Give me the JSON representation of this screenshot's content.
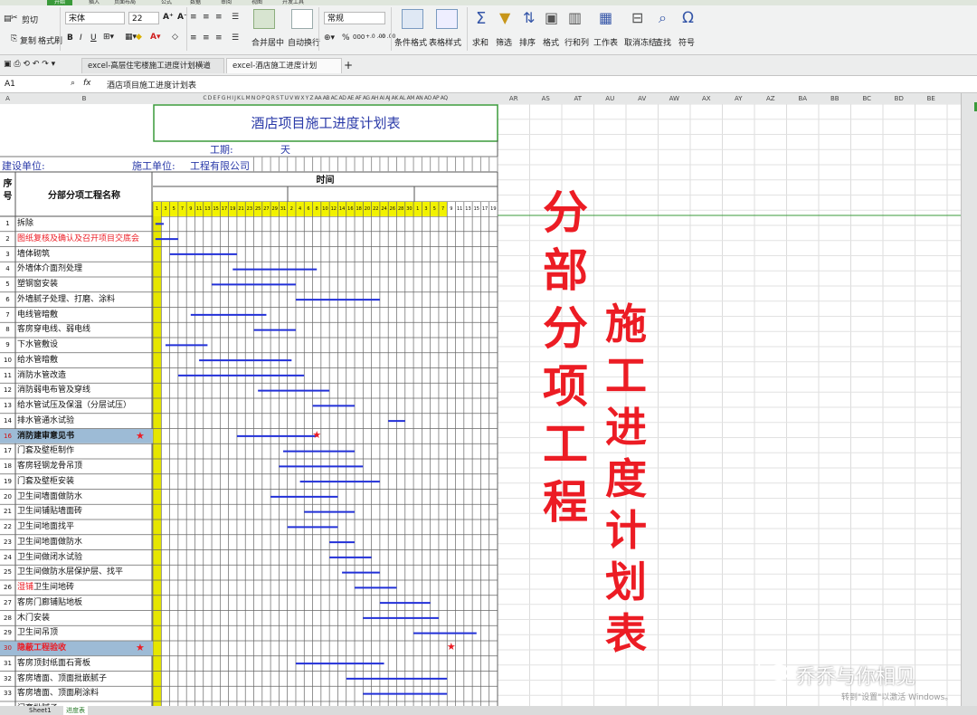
{
  "ribbon": {
    "tabs": [
      "开始",
      "插入",
      "页面布局",
      "公式",
      "数据",
      "审阅",
      "视图",
      "开发工具"
    ],
    "clipboard": {
      "cut": "剪切",
      "copy": "复制",
      "format_painter": "格式刷"
    },
    "font": {
      "name": "宋体",
      "size": "22"
    },
    "number_format": "常规",
    "buttons": {
      "merge_center": "合并居中",
      "wrap_text": "自动换行",
      "cond_format": "条件格式",
      "table_style": "表格样式",
      "sum": "求和",
      "filter": "筛选",
      "sort": "排序",
      "format": "格式",
      "rows_cols": "行和列",
      "worksheet": "工作表",
      "freeze": "取消冻结",
      "find": "查找",
      "symbol": "符号"
    },
    "font_buttons": [
      "B",
      "I",
      "U"
    ],
    "percent": "%",
    "thousands": "000",
    "dec_inc": "+.0 .00",
    "dec_dec": "-.0 .00"
  },
  "doc_tabs": {
    "tab1": "excel-高层住宅楼施工进度计划横道图.xls",
    "tab2": "excel-酒店施工进度计划表.xls",
    "new_tab": "+"
  },
  "formula_bar": {
    "name_box": "A1",
    "fx": "fx",
    "content": "酒店项目施工进度计划表"
  },
  "col_headers": {
    "a": "A",
    "b": "B",
    "mini": "C D E F G H I J K L M N O P Q R S T U V W X Y Z AA AB AC AD AE AF AG AH AI AJ AK AL AM AN AO AP AQ",
    "right": [
      "AR",
      "AS",
      "AT",
      "AU",
      "AV",
      "AW",
      "AX",
      "AY",
      "AZ",
      "BA",
      "BB",
      "BC",
      "BD",
      "BE"
    ]
  },
  "sheet": {
    "title": "酒店项目施工进度计划表",
    "duration_label": "工期:",
    "duration_unit": "天",
    "owner_label": "建设单位:",
    "contractor_label": "施工单位:",
    "contractor_name": "工程有限公司",
    "time_label": "时间",
    "seq_label": "序号",
    "task_header": "分部分项工程名称",
    "days": [
      "1",
      "3",
      "5",
      "7",
      "9",
      "11",
      "13",
      "15",
      "17",
      "19",
      "21",
      "23",
      "25",
      "27",
      "29",
      "31",
      "2",
      "4",
      "6",
      "8",
      "10",
      "12",
      "14",
      "16",
      "18",
      "20",
      "22",
      "24",
      "26",
      "28",
      "30",
      "1",
      "3",
      "5",
      "7",
      "9",
      "11",
      "13",
      "15",
      "17",
      "19"
    ],
    "star": "★",
    "rows": [
      {
        "n": "1",
        "name": "拆除",
        "s": 0.3,
        "e": 1.3
      },
      {
        "n": "2",
        "name": "图纸复核及确认及召开项目交底会",
        "s": 0.3,
        "e": 3,
        "red": true
      },
      {
        "n": "3",
        "name": "墙体砌筑",
        "s": 2,
        "e": 10
      },
      {
        "n": "4",
        "name": "外墙体介面剂处理",
        "s": 9.5,
        "e": 19.5
      },
      {
        "n": "5",
        "name": "塑钢窗安装",
        "s": 7,
        "e": 17
      },
      {
        "n": "6",
        "name": "外墙腻子处理、打磨、涂料",
        "s": 17,
        "e": 27
      },
      {
        "n": "7",
        "name": "电线管暗敷",
        "s": 4.5,
        "e": 13.5
      },
      {
        "n": "8",
        "name": "客房穿电线、弱电线",
        "s": 12,
        "e": 17
      },
      {
        "n": "9",
        "name": "下水管敷设",
        "s": 1.5,
        "e": 6.5
      },
      {
        "n": "10",
        "name": "给水管暗敷",
        "s": 5.5,
        "e": 16.5
      },
      {
        "n": "11",
        "name": "消防水管改造",
        "s": 3,
        "e": 18
      },
      {
        "n": "12",
        "name": "消防弱电布管及穿线",
        "s": 12.5,
        "e": 21
      },
      {
        "n": "13",
        "name": "给水管试压及保温（分层试压）",
        "s": 19,
        "e": 24
      },
      {
        "n": "14",
        "name": "排水管通水试验",
        "s": 28,
        "e": 30
      },
      {
        "n": "16",
        "name": "消防建审意见书",
        "s": 10,
        "e": 19.5,
        "hl": true,
        "star": 19.5
      },
      {
        "n": "17",
        "name": "门套及壁柜制作",
        "s": 15.5,
        "e": 24
      },
      {
        "n": "18",
        "name": "客房轻钢龙骨吊顶",
        "s": 15,
        "e": 25
      },
      {
        "n": "19",
        "name": "门套及壁柜安装",
        "s": 17.5,
        "e": 27
      },
      {
        "n": "20",
        "name": "卫生间墙面做防水",
        "s": 14,
        "e": 22
      },
      {
        "n": "21",
        "name": "卫生间铺贴墙面砖",
        "s": 18,
        "e": 24
      },
      {
        "n": "22",
        "name": "卫生间地面找平",
        "s": 16,
        "e": 22
      },
      {
        "n": "23",
        "name": "卫生间地面做防水",
        "s": 21,
        "e": 24
      },
      {
        "n": "24",
        "name": "卫生间做闭水试验",
        "s": 21,
        "e": 26
      },
      {
        "n": "25",
        "name": "卫生间做防水层保护层、找平",
        "s": 22.5,
        "e": 27
      },
      {
        "n": "26",
        "name": "湿铺卫生间地砖",
        "s": 24,
        "e": 29,
        "red_prefix": "湿铺"
      },
      {
        "n": "27",
        "name": "客房门廊铺贴地板",
        "s": 27,
        "e": 33
      },
      {
        "n": "28",
        "name": "木门安装",
        "s": 25,
        "e": 34
      },
      {
        "n": "29",
        "name": "卫生间吊顶",
        "s": 31,
        "e": 38.5
      },
      {
        "n": "30",
        "name": "隐蔽工程验收",
        "s": null,
        "e": null,
        "hl": true,
        "star": 35.5,
        "red": true
      },
      {
        "n": "31",
        "name": "客房顶封纸面石膏板",
        "s": 17,
        "e": 27.5
      },
      {
        "n": "32",
        "name": "客房墙面、顶面批嵌腻子",
        "s": 23,
        "e": 35
      },
      {
        "n": "33",
        "name": "客房墙面、顶面刷涂料",
        "s": 25,
        "e": 35
      },
      {
        "n": "34",
        "name": "门套批腻子",
        "s": 26,
        "e": 34
      }
    ]
  },
  "overlay": {
    "vertical1": [
      "分",
      "部",
      "分",
      "项",
      "工",
      "程"
    ],
    "vertical2": [
      "施",
      "工",
      "进",
      "度",
      "计",
      "划",
      "表"
    ],
    "watermark": "乔乔与你相见",
    "activate": "转到\"设置\"以激活 Windows。"
  },
  "sheet_tabs": [
    "Sheet1",
    "进度表"
  ],
  "colors": {
    "bar": "#2230d8",
    "title": "#2a3aa8",
    "red": "#ec1c24",
    "yellow": "#e6e600",
    "green": "#3a9a3a",
    "highlight": "#9dbbd6"
  }
}
